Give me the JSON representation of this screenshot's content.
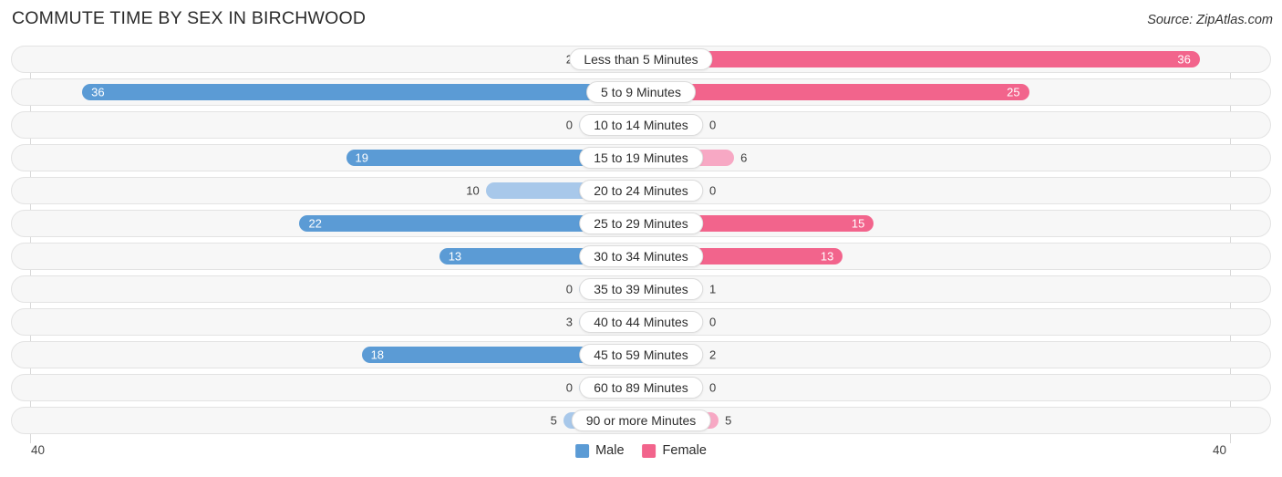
{
  "header": {
    "title": "COMMUTE TIME BY SEX IN BIRCHWOOD",
    "source": "Source: ZipAtlas.com"
  },
  "axis": {
    "left_tick": "40",
    "right_tick": "40"
  },
  "legend": {
    "items": [
      {
        "label": "Male",
        "color": "#5b9bd5"
      },
      {
        "label": "Female",
        "color": "#f2648c"
      }
    ]
  },
  "colors": {
    "male_strong": "#5b9bd5",
    "male_light": "#a8c8ea",
    "female_strong": "#f2648c",
    "female_light": "#f7a8c4",
    "track_bg": "#f7f7f7",
    "track_border": "#e3e3e3"
  },
  "chart_data": {
    "type": "bar",
    "title": "COMMUTE TIME BY SEX IN BIRCHWOOD",
    "subtitle": "",
    "xlabel": "",
    "ylabel": "",
    "orientation": "horizontal-diverging",
    "axis_max": 40,
    "xlim": [
      40,
      40
    ],
    "grid": false,
    "legend_position": "bottom-center",
    "categories": [
      "Less than 5 Minutes",
      "5 to 9 Minutes",
      "10 to 14 Minutes",
      "15 to 19 Minutes",
      "20 to 24 Minutes",
      "25 to 29 Minutes",
      "30 to 34 Minutes",
      "35 to 39 Minutes",
      "40 to 44 Minutes",
      "45 to 59 Minutes",
      "60 to 89 Minutes",
      "90 or more Minutes"
    ],
    "series": [
      {
        "name": "Male",
        "side": "left",
        "values": [
          2,
          36,
          0,
          19,
          10,
          22,
          13,
          0,
          3,
          18,
          0,
          5
        ]
      },
      {
        "name": "Female",
        "side": "right",
        "values": [
          36,
          25,
          0,
          6,
          0,
          15,
          13,
          1,
          0,
          2,
          0,
          5
        ]
      }
    ]
  }
}
